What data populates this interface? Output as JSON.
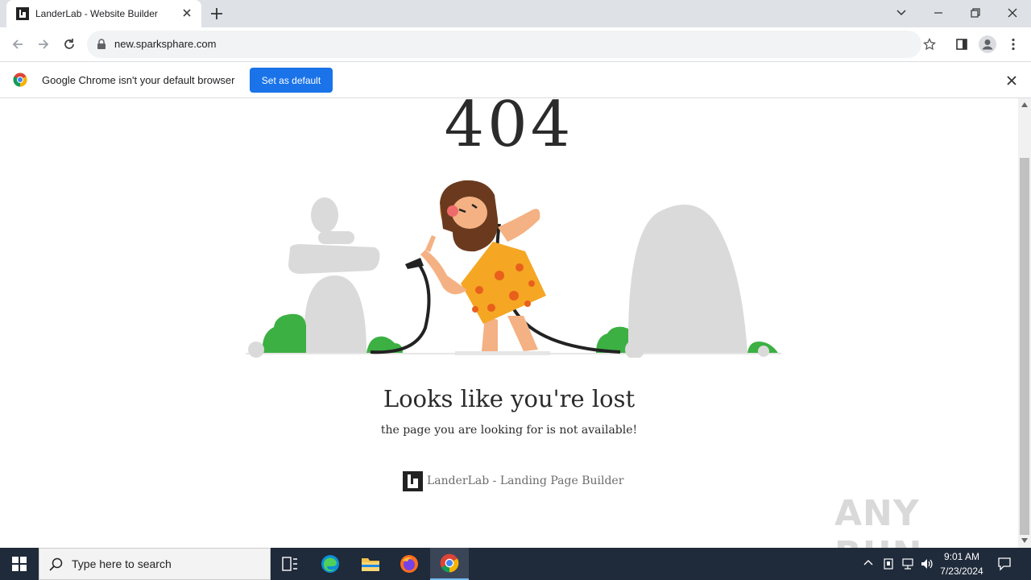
{
  "browser": {
    "tab_title": "LanderLab - Website Builder",
    "url": "new.sparksphare.com",
    "infobar_message": "Google Chrome isn't your default browser",
    "set_default_label": "Set as default",
    "accent_color": "#1a73e8",
    "icons": [
      "back-icon",
      "forward-icon",
      "reload-icon",
      "lock-icon",
      "share-icon",
      "star-icon",
      "side-panel-icon",
      "profile-icon",
      "menu-icon"
    ]
  },
  "page": {
    "code": "404",
    "headline": "Looks like you're lost",
    "subline": "the page you are looking for is not available!",
    "brand_text": "LanderLab - Landing Page Builder",
    "watermark": "ANY RUN"
  },
  "taskbar": {
    "search_placeholder": "Type here to search",
    "time": "9:01 AM",
    "date": "7/23/2024",
    "pinned": [
      "task-view-icon",
      "edge-icon",
      "file-explorer-icon",
      "firefox-icon",
      "chrome-icon"
    ]
  }
}
